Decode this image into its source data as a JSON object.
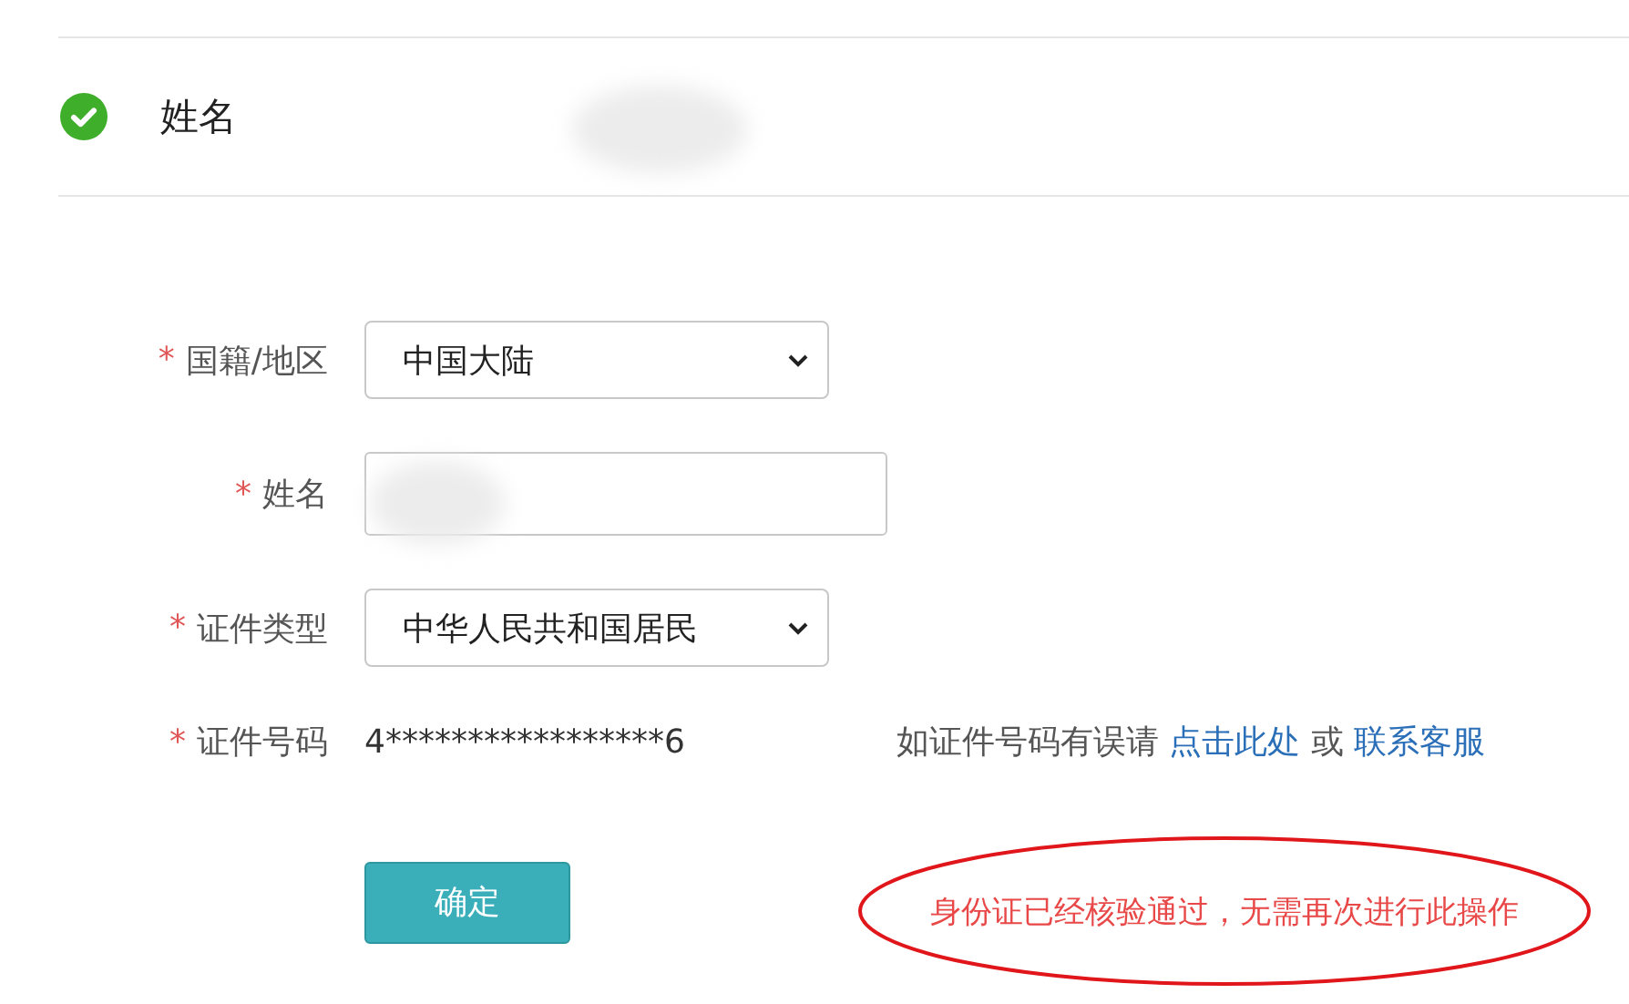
{
  "summary": {
    "verified": true,
    "label": "姓名",
    "value_redacted": true
  },
  "form": {
    "fields": [
      {
        "kind": "select",
        "label": "国籍/地区",
        "required_mark": "*",
        "value": "中国大陆"
      },
      {
        "kind": "input",
        "label": "姓名",
        "required_mark": "*",
        "redacted": true
      },
      {
        "kind": "select",
        "label": "证件类型",
        "required_mark": "*",
        "value": "中华人民共和国居民"
      },
      {
        "kind": "text",
        "label": "证件号码",
        "required_mark": "*",
        "value": "4*****************6",
        "hint": {
          "before": "如证件号码有误请",
          "link1": "点击此处",
          "middle": "或",
          "link2": "联系客服"
        }
      }
    ],
    "submit": "确定",
    "message": {
      "text": "身份证已经核验通过，无需再次进行此操作",
      "circled": true
    }
  }
}
